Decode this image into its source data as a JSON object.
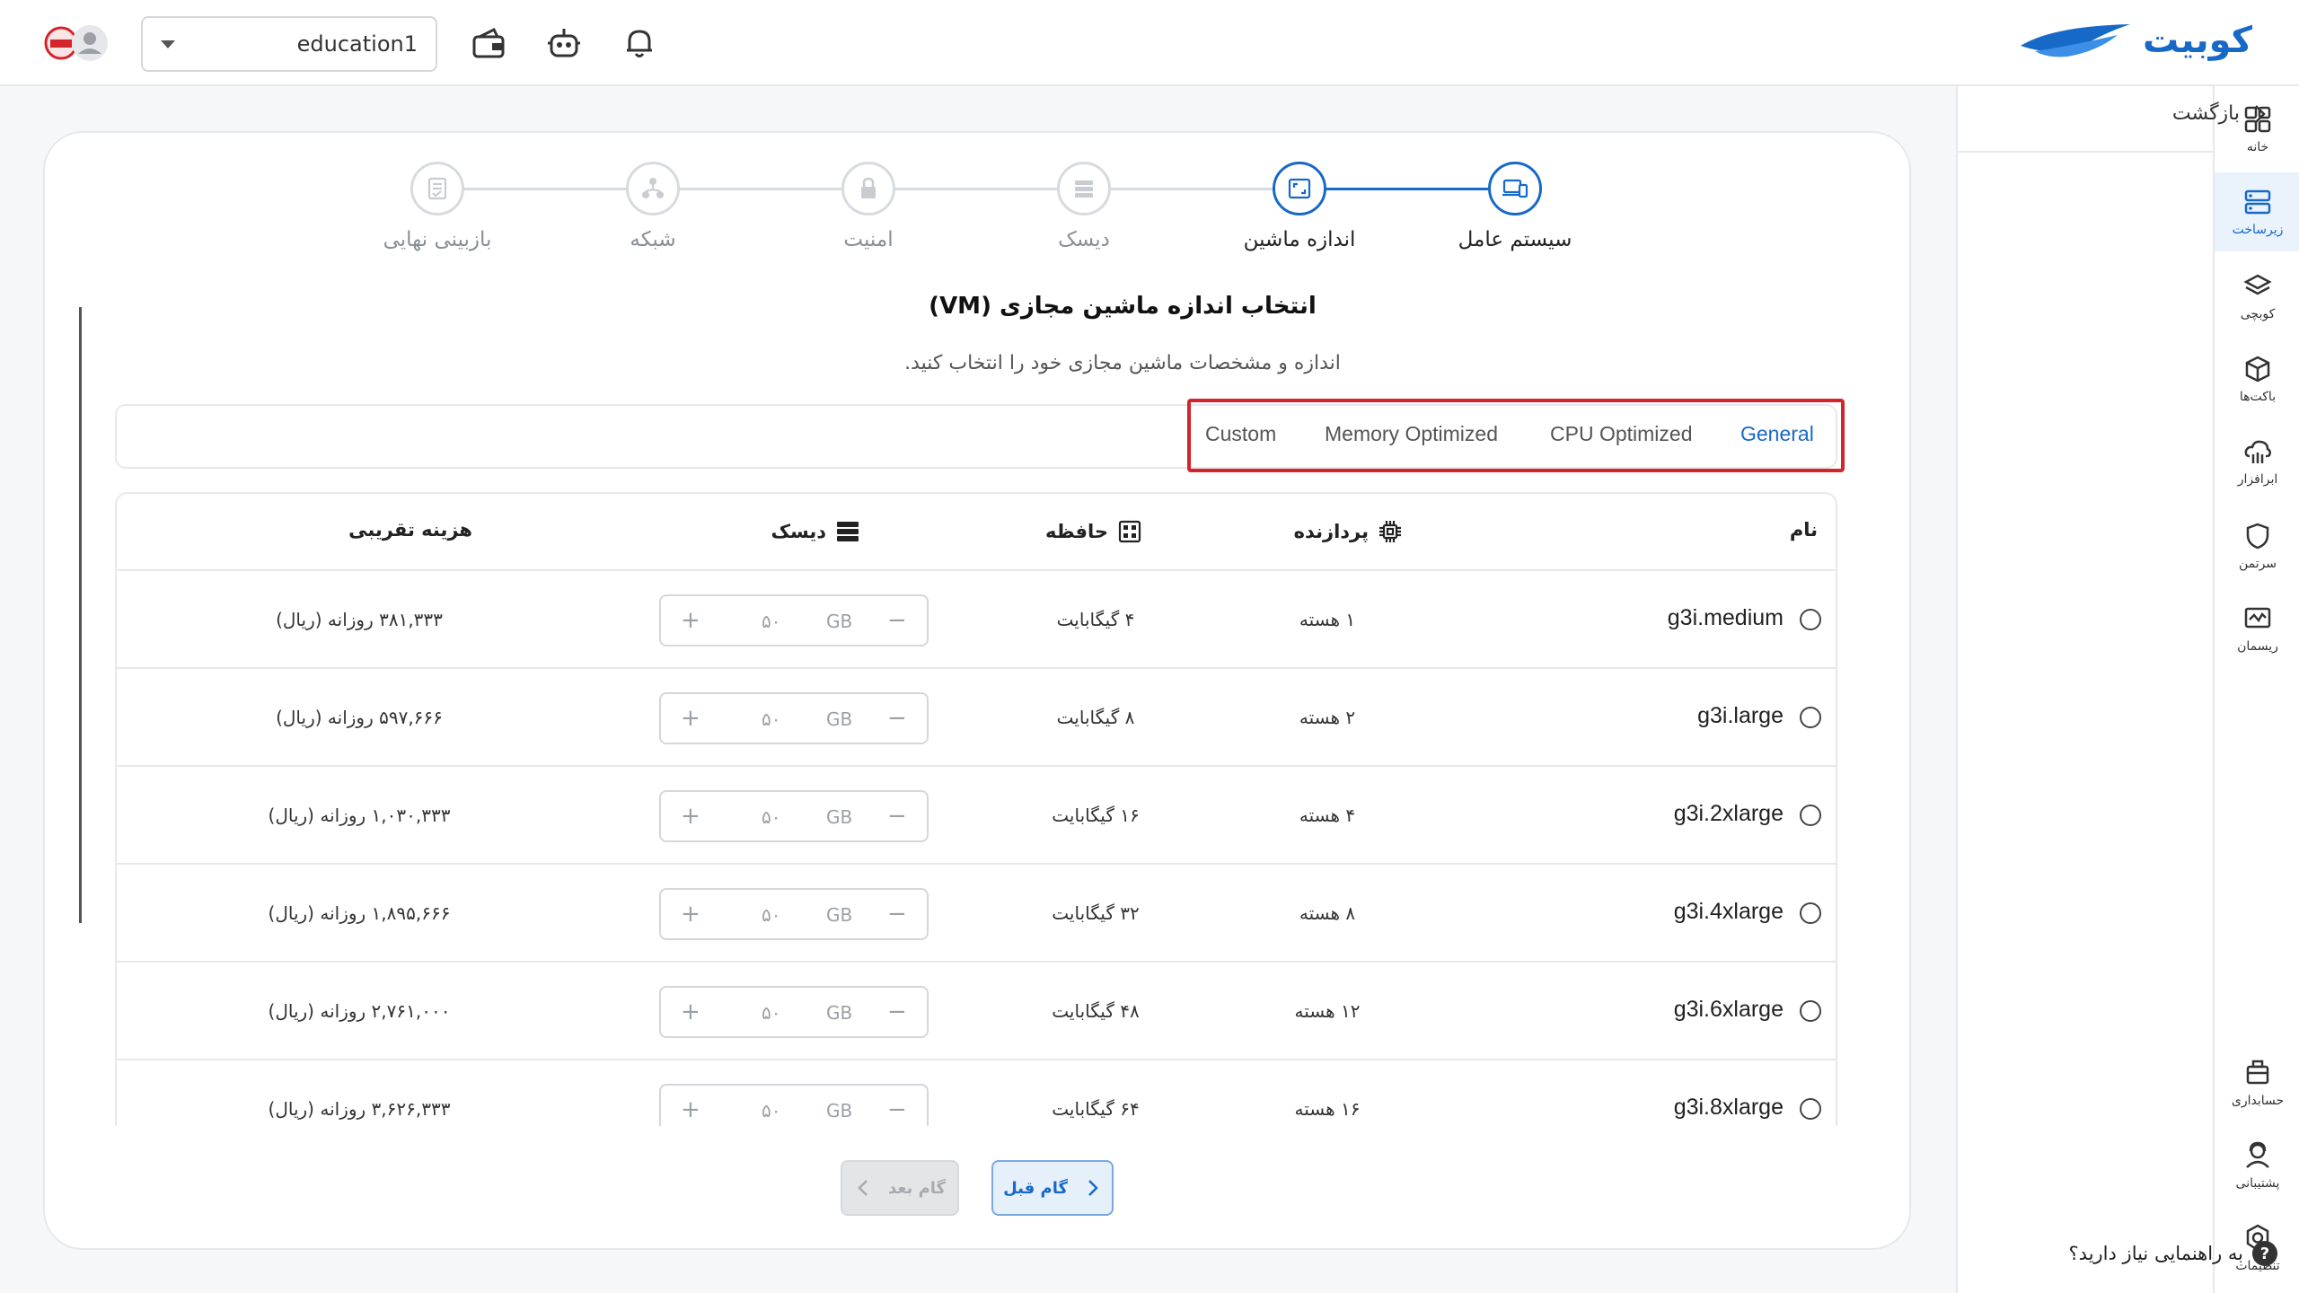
{
  "brand": {
    "name": "کوبیت",
    "color": "#1769c8"
  },
  "header": {
    "account": "education1",
    "icons": [
      "wallet-icon",
      "robot-icon",
      "bell-icon",
      "avatar"
    ]
  },
  "sidebar": {
    "items": [
      {
        "label": "خانه",
        "icon": "grid-icon"
      },
      {
        "label": "زیرساخت",
        "icon": "server-icon",
        "active": true
      },
      {
        "label": "کوبچی",
        "icon": "layers-icon"
      },
      {
        "label": "باکت‌ها",
        "icon": "cube-icon"
      },
      {
        "label": "ابرافزار",
        "icon": "cloud-app-icon"
      },
      {
        "label": "سرتمن",
        "icon": "shield-icon"
      },
      {
        "label": "ریسمان",
        "icon": "monitor-icon"
      }
    ],
    "bottom_items": [
      {
        "label": "حسابداری",
        "icon": "accounting-icon"
      },
      {
        "label": "پشتیبانی",
        "icon": "support-icon"
      },
      {
        "label": "تنظیمات",
        "icon": "settings-icon"
      }
    ]
  },
  "panel": {
    "back_label": "بازگشت",
    "help_label": "به راهنمایی نیاز دارید؟",
    "help_mark": "?"
  },
  "steps": [
    {
      "label": "سیستم عامل",
      "state": "done"
    },
    {
      "label": "اندازه ماشین",
      "state": "active"
    },
    {
      "label": "دیسک",
      "state": "pending"
    },
    {
      "label": "امنیت",
      "state": "pending"
    },
    {
      "label": "شبکه",
      "state": "pending"
    },
    {
      "label": "بازبینی نهایی",
      "state": "pending"
    }
  ],
  "section": {
    "title": "انتخاب اندازه ماشین مجازی (VM)",
    "subtitle": "اندازه و مشخصات ماشین مجازی خود را انتخاب کنید."
  },
  "tabs": [
    {
      "label": "General",
      "active": true
    },
    {
      "label": "CPU Optimized"
    },
    {
      "label": "Memory Optimized"
    },
    {
      "label": "Custom"
    }
  ],
  "table": {
    "headers": {
      "name": "نام",
      "cpu": "پردازنده",
      "memory": "حافظه",
      "disk": "دیسک",
      "cost": "هزینه تقریبی"
    },
    "disk_unit": "GB",
    "rows": [
      {
        "name": "g3i.medium",
        "cpu": "۱ هسته",
        "memory": "۴ گیگابایت",
        "disk": "۵۰",
        "cost": "۳۸۱,۳۳۳ روزانه (ریال)"
      },
      {
        "name": "g3i.large",
        "cpu": "۲ هسته",
        "memory": "۸ گیگابایت",
        "disk": "۵۰",
        "cost": "۵۹۷,۶۶۶ روزانه (ریال)"
      },
      {
        "name": "g3i.2xlarge",
        "cpu": "۴ هسته",
        "memory": "۱۶ گیگابایت",
        "disk": "۵۰",
        "cost": "۱,۰۳۰,۳۳۳ روزانه (ریال)"
      },
      {
        "name": "g3i.4xlarge",
        "cpu": "۸ هسته",
        "memory": "۳۲ گیگابایت",
        "disk": "۵۰",
        "cost": "۱,۸۹۵,۶۶۶ روزانه (ریال)"
      },
      {
        "name": "g3i.6xlarge",
        "cpu": "۱۲ هسته",
        "memory": "۴۸ گیگابایت",
        "disk": "۵۰",
        "cost": "۲,۷۶۱,۰۰۰ روزانه (ریال)"
      },
      {
        "name": "g3i.8xlarge",
        "cpu": "۱۶ هسته",
        "memory": "۶۴ گیگابایت",
        "disk": "۵۰",
        "cost": "۳,۶۲۶,۳۳۳ روزانه (ریال)"
      }
    ]
  },
  "buttons": {
    "prev": "گام قبل",
    "next": "گام بعد"
  }
}
